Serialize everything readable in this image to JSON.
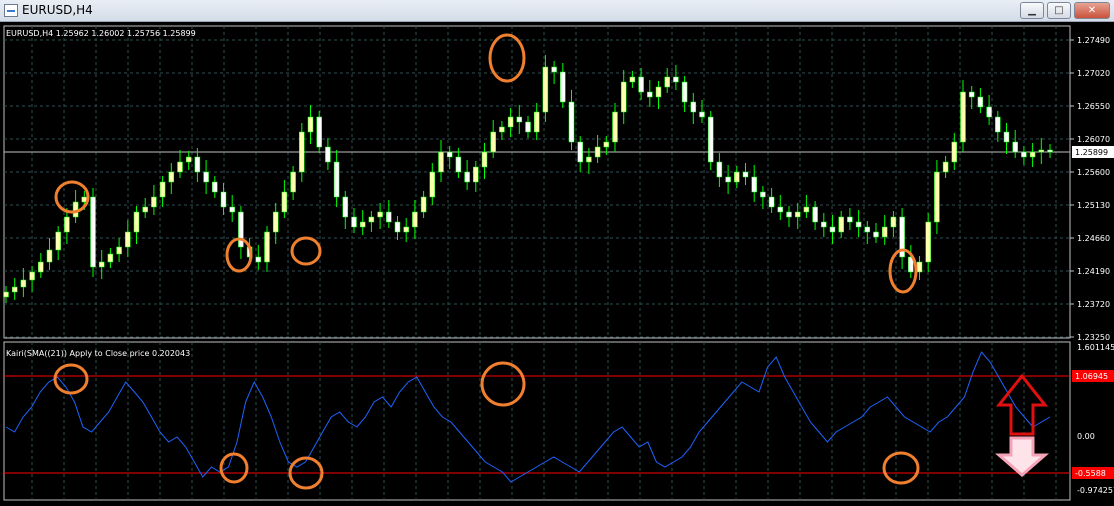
{
  "window": {
    "title": "EURUSD,H4"
  },
  "chart": {
    "info": "EURUSD,H4  1.25962 1.26002 1.25756 1.25899",
    "current_price": "1.25899",
    "price_axis": [
      "1.27490",
      "1.27020",
      "1.26550",
      "1.26070",
      "1.25600",
      "1.25130",
      "1.24660",
      "1.24190",
      "1.23720",
      "1.23250"
    ],
    "colors": {
      "bull": "#ffffaf",
      "bear": "#ffffff",
      "wick": "#00ff00",
      "grid": "#2f4f4f",
      "marker": "#f08030",
      "line": "#1e64ff",
      "level": "#ff0000",
      "arrow_up": "#e01010",
      "arrow_down": "#f5a3b8"
    }
  },
  "indicator": {
    "label": "Kairi(SMA((21)) Apply to Close price 0.202043",
    "axis": [
      "1.601145",
      "0.00",
      "-0.974257"
    ],
    "upper_level": "1.06945",
    "lower_level": "-0.5588"
  }
}
